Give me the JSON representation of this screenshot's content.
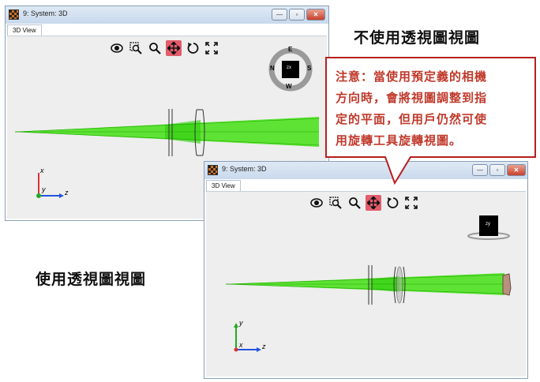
{
  "window_top": {
    "title": "9: System: 3D",
    "tab": "3D View",
    "min_glyph": "—",
    "max_glyph": "▫",
    "close_glyph": "✕",
    "compass": {
      "north": "N",
      "east": "E",
      "south": "S",
      "west": "W",
      "cube": "zx"
    },
    "axes": {
      "x": "x",
      "y": "y",
      "z": "z"
    }
  },
  "window_bottom": {
    "title": "9: System: 3D",
    "tab": "3D View",
    "min_glyph": "—",
    "max_glyph": "▫",
    "close_glyph": "✕",
    "cube": "zy",
    "axes": {
      "x": "x",
      "y": "y",
      "z": "z"
    }
  },
  "toolbar_icons": [
    "orbit-icon",
    "zoom-window-icon",
    "zoom-icon",
    "pan-icon",
    "rotate-icon",
    "fit-icon"
  ],
  "label_top": "不使用透視圖視圖",
  "label_bottom": "使用透視圖視圖",
  "callout": {
    "lines": [
      "注意：當使用預定義的相機",
      "方向時，會將視圖調整到指",
      "定的平面，但用戶仍然可使",
      "用旋轉工具旋轉視圖。"
    ]
  },
  "colors": {
    "beam": "#33dd11",
    "callout_border": "#b52020",
    "callout_text": "#c0392b",
    "active_tool": "#e25c6c"
  }
}
